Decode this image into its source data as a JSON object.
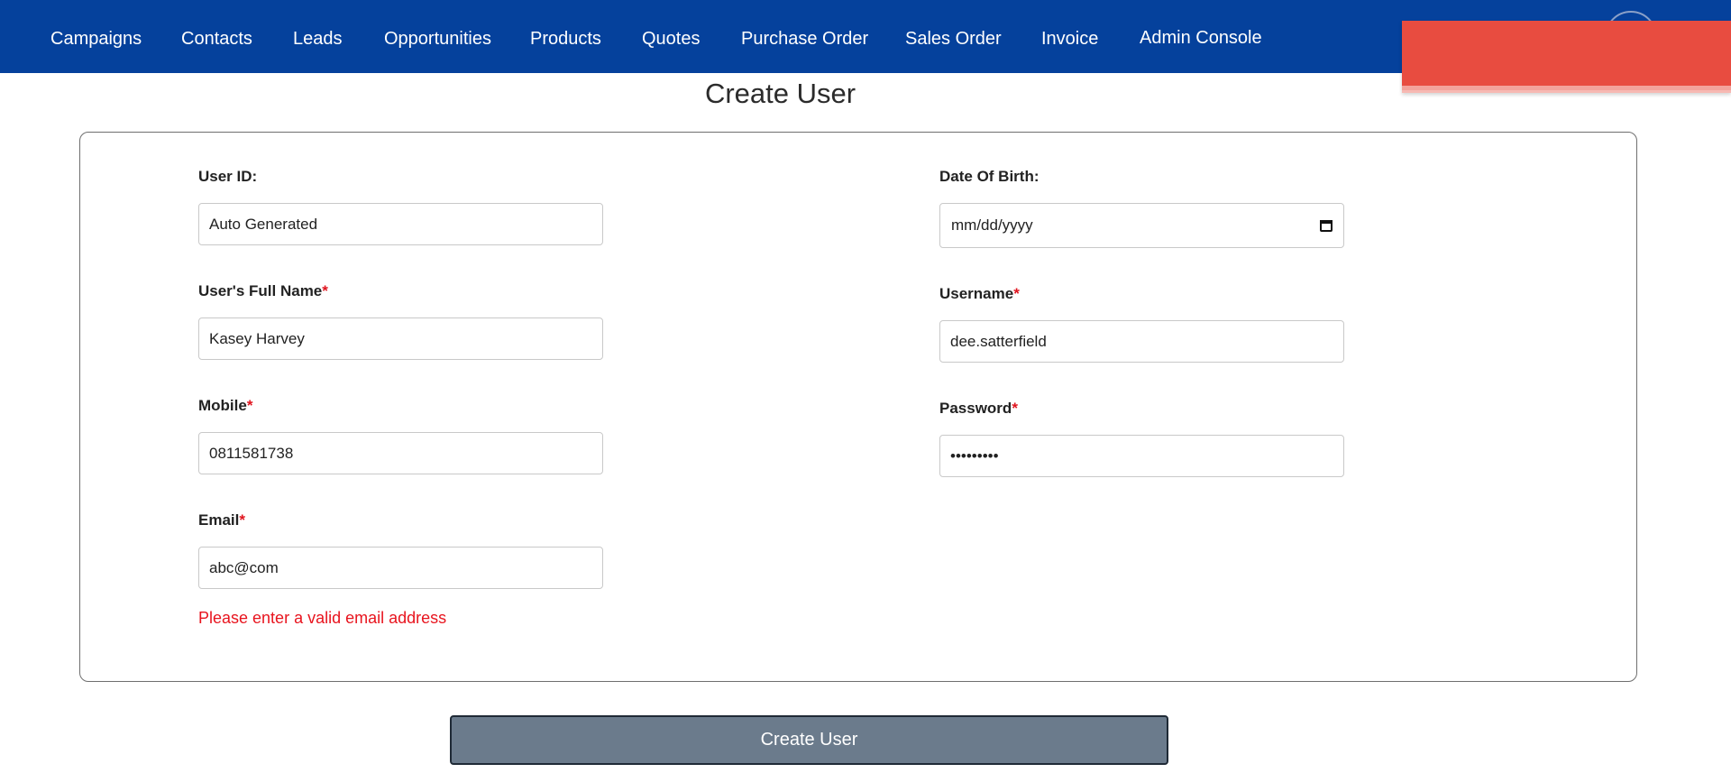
{
  "nav": {
    "items": [
      {
        "label": "Campaigns"
      },
      {
        "label": "Contacts"
      },
      {
        "label": "Leads"
      },
      {
        "label": "Opportunities"
      },
      {
        "label": "Products"
      },
      {
        "label": "Quotes"
      },
      {
        "label": "Purchase Order"
      },
      {
        "label": "Sales Order"
      },
      {
        "label": "Invoice"
      },
      {
        "label": "Admin Console"
      }
    ]
  },
  "page": {
    "title": "Create User"
  },
  "form": {
    "user_id": {
      "label": "User ID:",
      "value": "Auto Generated"
    },
    "full_name": {
      "label": "User's Full Name",
      "required": "*",
      "value": "Kasey Harvey"
    },
    "mobile": {
      "label": "Mobile",
      "required": "*",
      "value": "0811581738"
    },
    "email": {
      "label": "Email",
      "required": "*",
      "value": "abc@com",
      "error": "Please enter a valid email address"
    },
    "dob": {
      "label": "Date Of Birth:",
      "placeholder": "mm/dd/yyyy"
    },
    "username": {
      "label": "Username",
      "required": "*",
      "value": "dee.satterfield"
    },
    "password": {
      "label": "Password",
      "required": "*",
      "value": "•••••••••"
    },
    "submit_label": "Create User"
  },
  "colors": {
    "navbar": "#05419c",
    "toast": "#e84c40",
    "error": "#e8141e",
    "button": "#6b7b8c"
  },
  "icons": {
    "dob_picker": "calendar-icon"
  }
}
